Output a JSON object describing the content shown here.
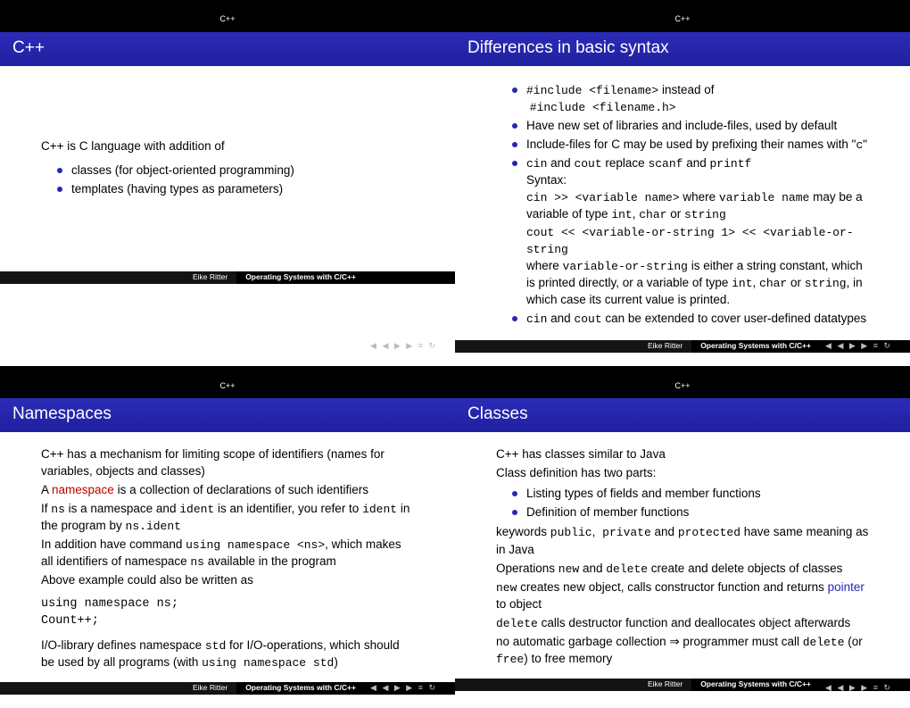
{
  "common": {
    "header_tag": "C++",
    "author": "Eike Ritter",
    "footer_title": "Operating Systems with C/C++",
    "navdots": "◀ ◀ ▶ ▶ ≡ ↻"
  },
  "slides": [
    {
      "title": "C++",
      "intro": "C++ is C language with addition of",
      "bullets": [
        "classes (for object-oriented programming)",
        "templates (having types as parameters)"
      ]
    },
    {
      "title": "Differences in basic syntax",
      "b1_pre": "#include <filename>",
      "b1_mid": " instead of",
      "b1_sub": "#include <filename.h>",
      "b2": "Have new set of libraries and include-files, used by default",
      "b3a": "Include-files for C may be used by prefixing their names with \"",
      "b3b": "c",
      "b3c": "\"",
      "b4_cin": "cin",
      "b4_and": " and ",
      "b4_cout": "cout",
      "b4_rep": " replace ",
      "b4_scanf": "scanf",
      "b4_printf": "printf",
      "syntax_label": "Syntax:",
      "cin_ex": " cin >> <variable name>",
      "cin_where": "  where ",
      "cin_var": "variable name",
      "cin_may": " may be a variable of type ",
      "t_int": "int",
      "t_char": "char",
      "t_or": " or ",
      "t_string": "string",
      "cout_ex": " cout << <variable-or-string 1> << <variable-or-string",
      "cout_where": "where ",
      "cout_vos": "variable-or-string",
      "cout_rest1": " is either a string constant, which is printed directly, or a variable of type ",
      "cout_rest2": ", in which case its current value is printed.",
      "ext1": "cin",
      "ext2": "cout",
      "ext_txt": " can be extended to cover user-defined datatypes"
    },
    {
      "title": "Namespaces",
      "p1": "C++ has a mechanism for limiting scope of identifiers (names for variables, objects and classes)",
      "p2a": "A ",
      "p2_ns": "namespace",
      "p2b": " is a collection of declarations of such identifiers",
      "p3a": "If ",
      "p3_ns": "ns",
      "p3b": " is a namespace and ",
      "p3_ident": "ident",
      "p3c": " is an identifier, you refer to ",
      "p3d": " in the program by ",
      "p3_nsident": "ns.ident",
      "p4a": "In addition have command  ",
      "p4_cmd": "using namespace <ns>",
      "p4b": ", which makes all identifiers of namespace ",
      "p4c": " available in the program",
      "p5": "Above example could also be written as",
      "code1": "using namespace ns;",
      "code2": "Count++;",
      "p6a": "I/O-library defines namespace ",
      "p6_std": "std",
      "p6b": " for I/O-operations, which should be used by all programs (with  ",
      "p6_cmd": "using namespace std",
      "p6c": ")"
    },
    {
      "title": "Classes",
      "p1": "C++ has classes similar to Java",
      "p2": "Class definition has two parts:",
      "b1": "Listing types of fields and member functions",
      "b2": "Definition of member functions",
      "p3a": "keywords ",
      "kw_pub": "public",
      "kw_priv": " private",
      "kw_and": " and ",
      "kw_prot": "protected",
      "p3b": " have same meaning as in Java",
      "p4a": "Operations ",
      "op_new": "new",
      "op_del": "delete",
      "p4b": " create and delete objects of classes",
      "p5a": " creates new object, calls constructor function and returns ",
      "p5_ptr": "pointer",
      "p5b": " to object",
      "p6a": " calls destructor function and deallocates object afterwards",
      "p7a": "no automatic garbage collection ⇒ programmer must call ",
      "p7b": " (or ",
      "op_free": "free",
      "p7c": ") to free memory"
    }
  ]
}
